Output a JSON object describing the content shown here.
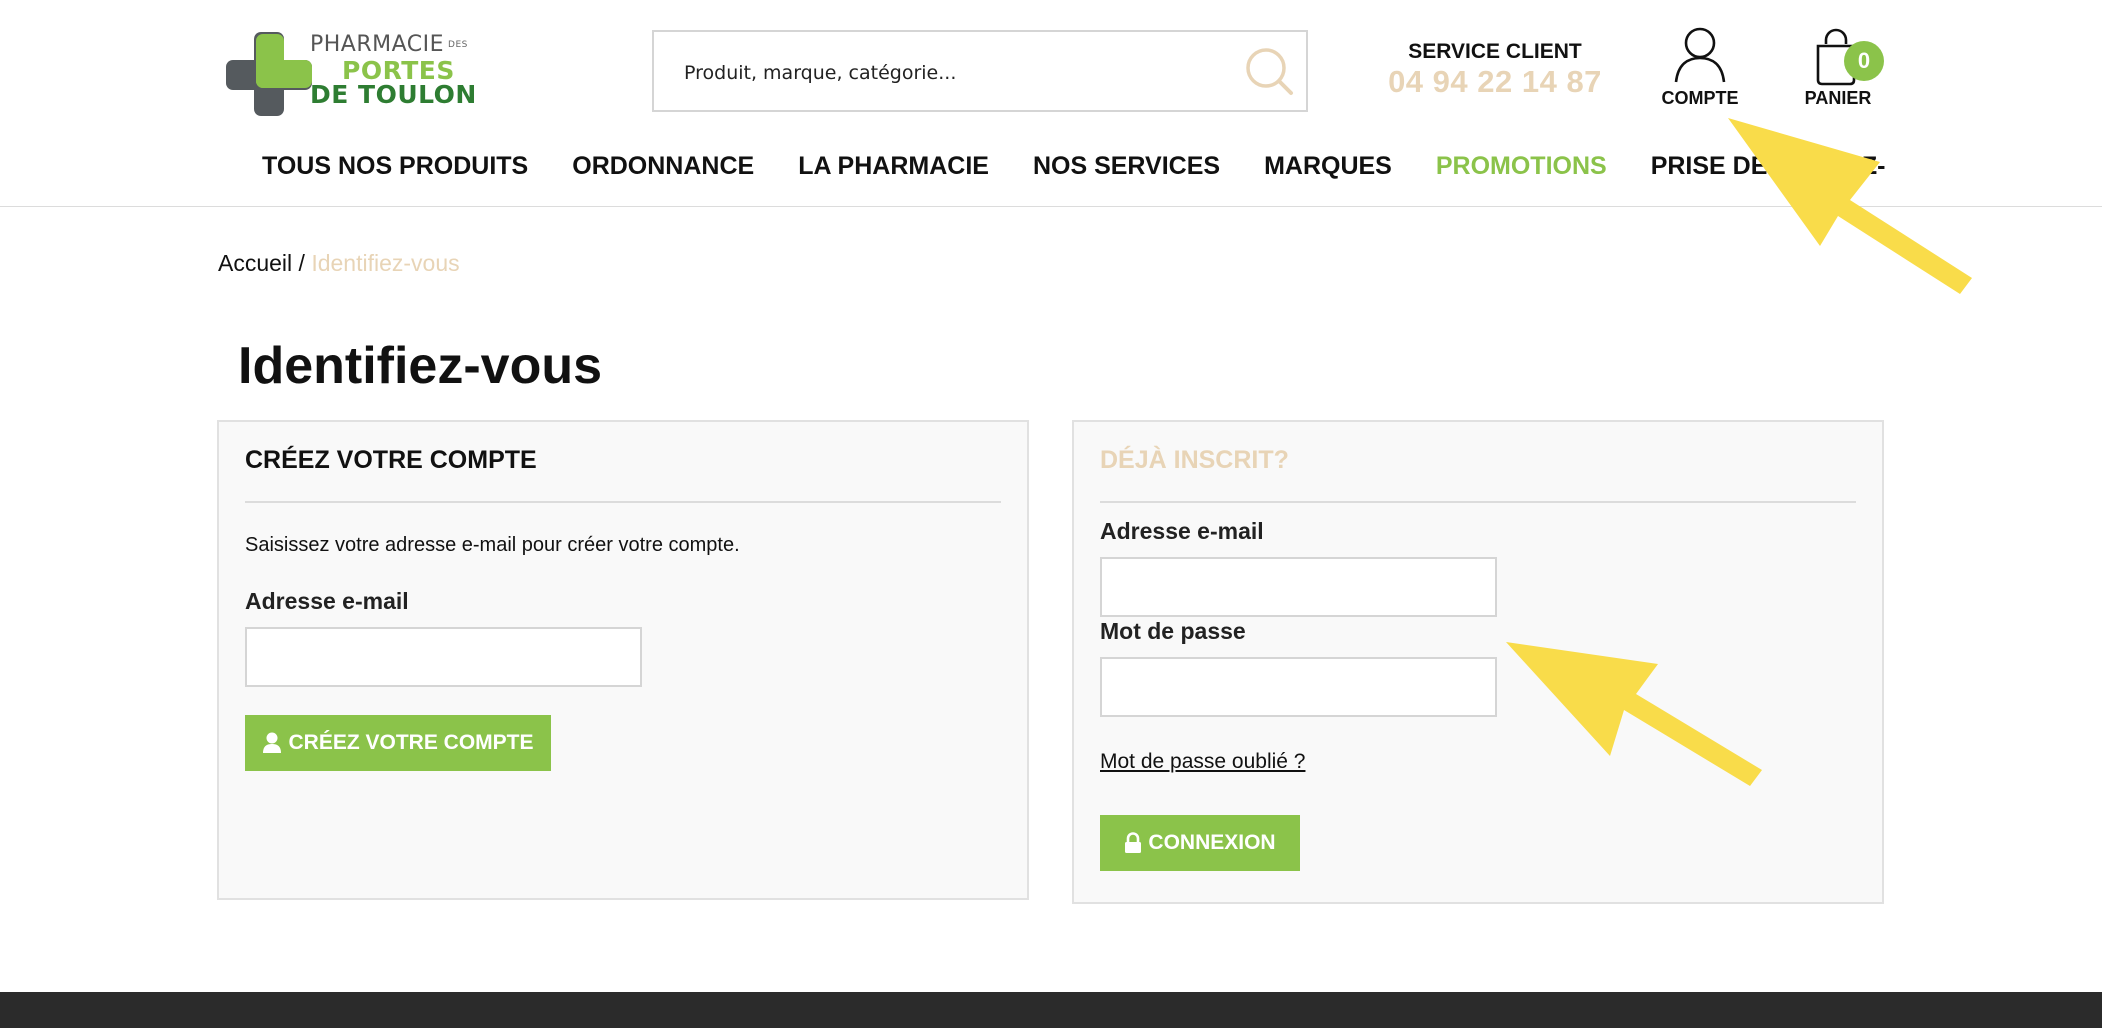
{
  "logo": {
    "line1": "PHARMACIE",
    "line1_small": "DES",
    "line2": "PORTES",
    "line3": "DE TOULON"
  },
  "search": {
    "placeholder": "Produit, marque, catégorie..."
  },
  "service_client": {
    "title": "SERVICE CLIENT",
    "phone": "04 94 22 14 87"
  },
  "account": {
    "label": "COMPTE"
  },
  "cart": {
    "label": "PANIER",
    "count": "0"
  },
  "nav": {
    "items": [
      {
        "label": "TOUS NOS PRODUITS"
      },
      {
        "label": "ORDONNANCE"
      },
      {
        "label": "LA PHARMACIE"
      },
      {
        "label": "NOS SERVICES"
      },
      {
        "label": "MARQUES"
      },
      {
        "label": "PROMOTIONS"
      },
      {
        "label": "PRISE DE RENDEZ-"
      }
    ]
  },
  "breadcrumb": {
    "home": "Accueil",
    "separator": " / ",
    "current": "Identifiez-vous"
  },
  "page_title": "Identifiez-vous",
  "create_account": {
    "heading": "CRÉEZ VOTRE COMPTE",
    "description": "Saisissez votre adresse e-mail pour créer votre compte.",
    "email_label": "Adresse e-mail",
    "email_value": "",
    "button_label": "CRÉEZ VOTRE COMPTE"
  },
  "login": {
    "heading": "DÉJÀ INSCRIT?",
    "email_label": "Adresse e-mail",
    "email_value": "",
    "password_label": "Mot de passe",
    "password_value": "",
    "forgot_label": "Mot de passe oublié ?",
    "button_label": "CONNEXION"
  },
  "colors": {
    "accent_green": "#8bc34a",
    "dark_green": "#2e7d32",
    "beige": "#e8d4b6",
    "annotation_yellow": "#f9dc4a",
    "footer": "#2b2b2b"
  },
  "icons": [
    "search-icon",
    "user-icon",
    "cart-bag-icon",
    "person-icon",
    "lock-icon"
  ]
}
